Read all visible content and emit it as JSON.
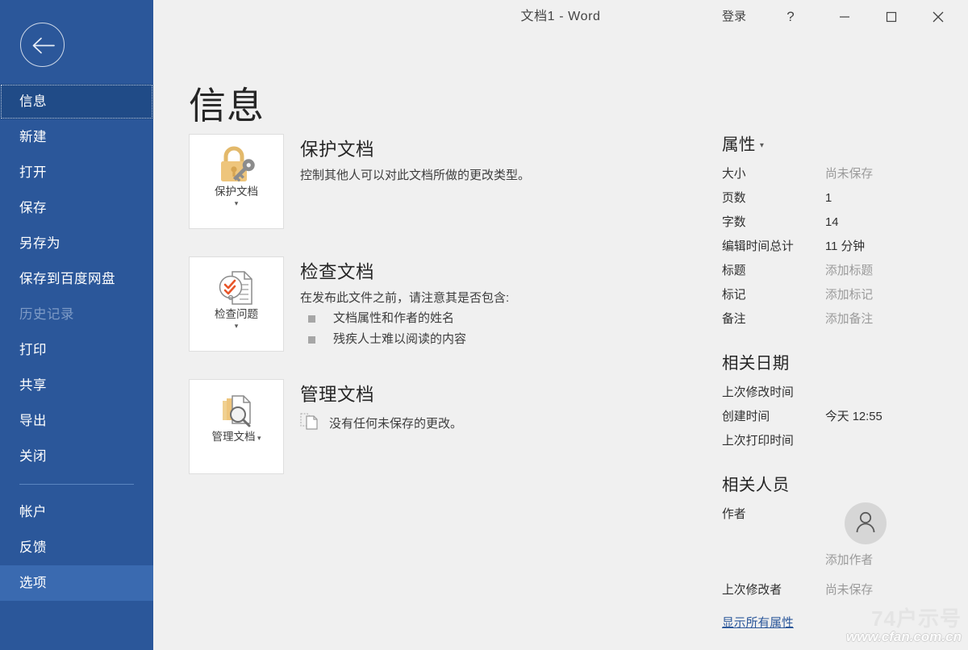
{
  "window": {
    "title": "文档1 - Word",
    "signin_label": "登录",
    "help_label": "?",
    "minimize_label": "—",
    "maximize_label": "❐",
    "close_label": "✕",
    "accent_color": "#2b579a",
    "chrome_background": "#f0f0f0"
  },
  "sidebar": {
    "back_label": "返回",
    "background_color": "#2b579a",
    "selected_color": "#204b87",
    "hover_color": "#3a6ab0",
    "items": [
      {
        "label": "信息",
        "state": "selected"
      },
      {
        "label": "新建",
        "state": "normal"
      },
      {
        "label": "打开",
        "state": "normal"
      },
      {
        "label": "保存",
        "state": "normal"
      },
      {
        "label": "另存为",
        "state": "normal"
      },
      {
        "label": "保存到百度网盘",
        "state": "normal"
      },
      {
        "label": "历史记录",
        "state": "disabled"
      },
      {
        "label": "打印",
        "state": "normal"
      },
      {
        "label": "共享",
        "state": "normal"
      },
      {
        "label": "导出",
        "state": "normal"
      },
      {
        "label": "关闭",
        "state": "normal"
      }
    ],
    "bottom_items": [
      {
        "label": "帐户",
        "state": "normal"
      },
      {
        "label": "反馈",
        "state": "normal"
      },
      {
        "label": "选项",
        "state": "hover"
      }
    ]
  },
  "main": {
    "page_title": "信息",
    "blocks": [
      {
        "tile_label": "保护文档",
        "tile_icon": "lock-key-icon",
        "title": "保护文档",
        "desc": "控制其他人可以对此文档所做的更改类型。",
        "bullets": []
      },
      {
        "tile_label": "检查问题",
        "tile_icon": "document-inspect-icon",
        "title": "检查文档",
        "desc": "在发布此文件之前，请注意其是否包含:",
        "bullets": [
          "文档属性和作者的姓名",
          "残疾人士难以阅读的内容"
        ]
      },
      {
        "tile_label": "管理文档",
        "tile_icon": "document-manage-icon",
        "title": "管理文档",
        "desc": "没有任何未保存的更改。",
        "desc_icon": "unsaved-document-icon",
        "bullets": []
      }
    ]
  },
  "properties": {
    "heading": "属性",
    "caret": "▾",
    "rows": [
      {
        "key": "大小",
        "value": "尚未保存",
        "muted": true
      },
      {
        "key": "页数",
        "value": "1",
        "muted": false
      },
      {
        "key": "字数",
        "value": "14",
        "muted": false
      },
      {
        "key": "编辑时间总计",
        "value": "11 分钟",
        "muted": false
      },
      {
        "key": "标题",
        "value": "添加标题",
        "muted": true
      },
      {
        "key": "标记",
        "value": "添加标记",
        "muted": true
      },
      {
        "key": "备注",
        "value": "添加备注",
        "muted": true
      }
    ]
  },
  "dates": {
    "heading": "相关日期",
    "rows": [
      {
        "key": "上次修改时间",
        "value": "",
        "muted": true
      },
      {
        "key": "创建时间",
        "value": "今天 12:55",
        "muted": false
      },
      {
        "key": "上次打印时间",
        "value": "",
        "muted": true
      }
    ]
  },
  "people": {
    "heading": "相关人员",
    "author_label": "作者",
    "author_add": "添加作者",
    "avatar_icon": "person-avatar-icon",
    "last_modified_by_label": "上次修改者",
    "last_modified_by_value": "尚未保存",
    "show_all_props": "显示所有属性",
    "link_color": "#2b579a"
  },
  "watermark": {
    "top": "74户示号",
    "bottom": "www.cfan.com.cn"
  }
}
